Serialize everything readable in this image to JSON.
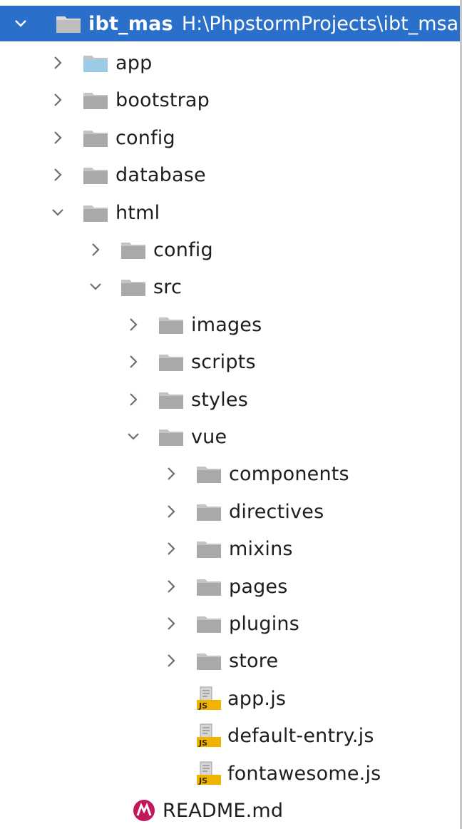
{
  "root": {
    "name": "ibt_mas",
    "path": "H:\\PhpstormProjects\\ibt_msa",
    "expanded": true
  },
  "items": [
    {
      "label": "app",
      "depth": 1,
      "kind": "folder",
      "expanded": false,
      "color": "#9ccbe8"
    },
    {
      "label": "bootstrap",
      "depth": 1,
      "kind": "folder",
      "expanded": false
    },
    {
      "label": "config",
      "depth": 1,
      "kind": "folder",
      "expanded": false
    },
    {
      "label": "database",
      "depth": 1,
      "kind": "folder",
      "expanded": false
    },
    {
      "label": "html",
      "depth": 1,
      "kind": "folder",
      "expanded": true
    },
    {
      "label": "config",
      "depth": 2,
      "kind": "folder",
      "expanded": false
    },
    {
      "label": "src",
      "depth": 2,
      "kind": "folder",
      "expanded": true
    },
    {
      "label": "images",
      "depth": 3,
      "kind": "folder",
      "expanded": false
    },
    {
      "label": "scripts",
      "depth": 3,
      "kind": "folder",
      "expanded": false
    },
    {
      "label": "styles",
      "depth": 3,
      "kind": "folder",
      "expanded": false
    },
    {
      "label": "vue",
      "depth": 3,
      "kind": "folder",
      "expanded": true
    },
    {
      "label": "components",
      "depth": 4,
      "kind": "folder",
      "expanded": false
    },
    {
      "label": "directives",
      "depth": 4,
      "kind": "folder",
      "expanded": false
    },
    {
      "label": "mixins",
      "depth": 4,
      "kind": "folder",
      "expanded": false
    },
    {
      "label": "pages",
      "depth": 4,
      "kind": "folder",
      "expanded": false
    },
    {
      "label": "plugins",
      "depth": 4,
      "kind": "folder",
      "expanded": false
    },
    {
      "label": "store",
      "depth": 4,
      "kind": "folder",
      "expanded": false
    },
    {
      "label": "app.js",
      "depth": 4,
      "kind": "js"
    },
    {
      "label": "default-entry.js",
      "depth": 4,
      "kind": "js"
    },
    {
      "label": "fontawesome.js",
      "depth": 4,
      "kind": "js"
    },
    {
      "label": "README.md",
      "depth": 3,
      "kind": "md"
    }
  ],
  "icons": {
    "folder": "folder-icon",
    "js": "javascript-file-icon",
    "md": "markdown-file-icon",
    "chevron_right": "chevron-right-icon",
    "chevron_down": "chevron-down-icon",
    "js_badge_text": "JS"
  },
  "colors": {
    "selection": "#2a6fc9",
    "folder": "#a9a9a9",
    "folder_light": "#c4c4c4",
    "js_badge": "#f0b400",
    "md_icon": "#c2185b"
  }
}
